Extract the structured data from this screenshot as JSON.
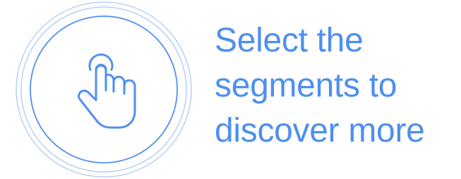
{
  "accent_color": "#4e8ff0",
  "ring_color_light": "#aacaf8",
  "icon": "pointing-hand-icon",
  "hint": {
    "lines": [
      "Select the",
      "segments to",
      "discover more"
    ]
  }
}
